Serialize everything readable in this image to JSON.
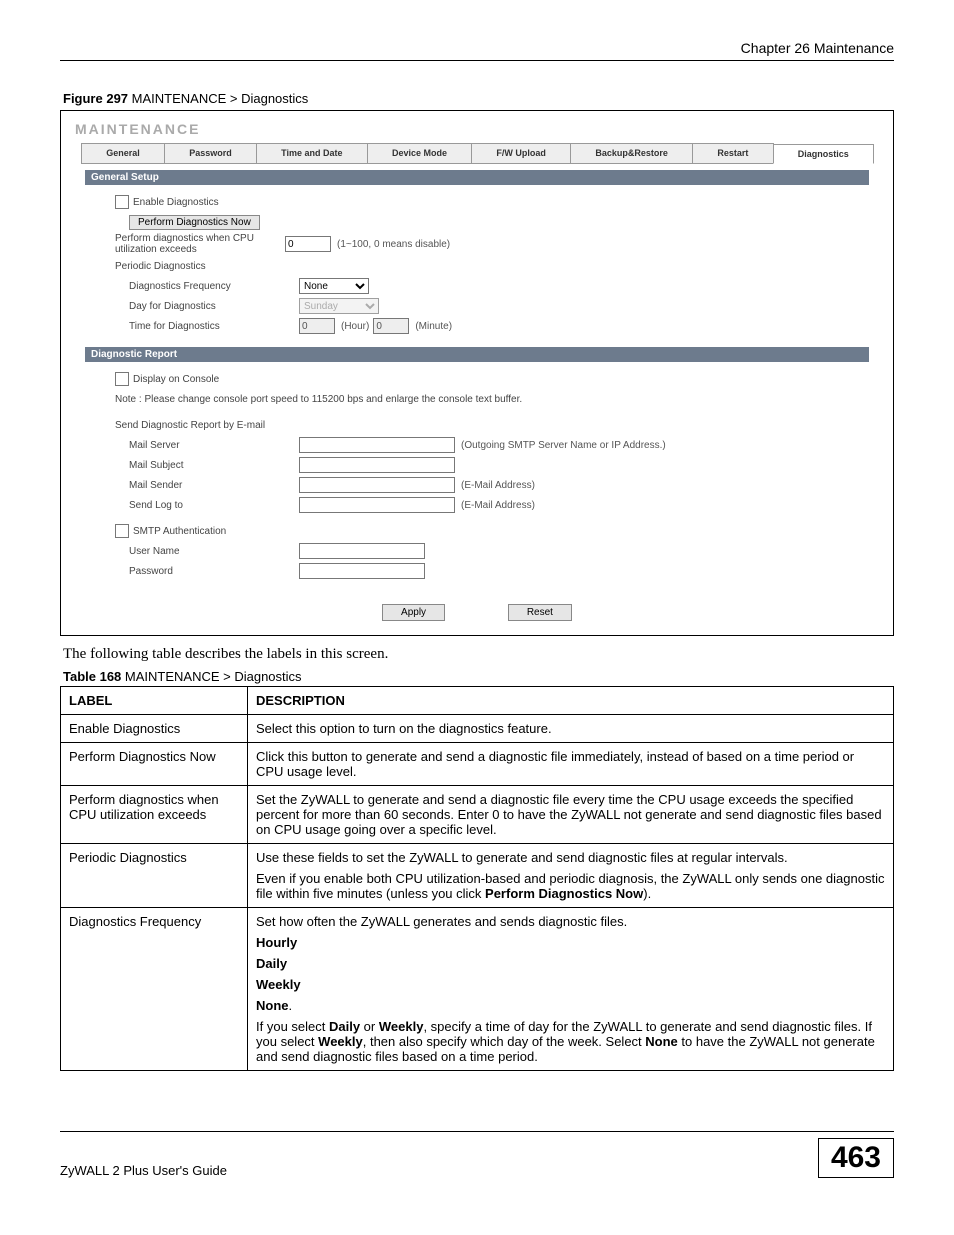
{
  "chapter_header": "Chapter 26 Maintenance",
  "figure_caption_strong": "Figure 297",
  "figure_caption_rest": "   MAINTENANCE > Diagnostics",
  "screenshot": {
    "page_title": "MAINTENANCE",
    "tabs": [
      "General",
      "Password",
      "Time and Date",
      "Device Mode",
      "F/W Upload",
      "Backup&Restore",
      "Restart",
      "Diagnostics"
    ],
    "active_tab_index": 7,
    "section1_title": "General Setup",
    "enable_diag": "Enable Diagnostics",
    "perform_now_btn": "Perform Diagnostics Now",
    "cpu_label": "Perform diagnostics when CPU utilization exceeds",
    "cpu_value": "0",
    "cpu_hint": "(1~100, 0 means disable)",
    "periodic_label": "Periodic Diagnostics",
    "freq_label": "Diagnostics Frequency",
    "freq_value": "None",
    "day_label": "Day for Diagnostics",
    "day_value": "Sunday",
    "time_label": "Time for Diagnostics",
    "time_hour": "0",
    "time_hour_hint": "(Hour)",
    "time_min": "0",
    "time_min_hint": "(Minute)",
    "section2_title": "Diagnostic Report",
    "console_label": "Display on Console",
    "console_note": "Note : Please change console port speed to 115200 bps and enlarge the console text buffer.",
    "email_header": "Send Diagnostic Report by E-mail",
    "mail_server_label": "Mail Server",
    "mail_server_hint": "(Outgoing SMTP Server Name or IP Address.)",
    "mail_subject_label": "Mail Subject",
    "mail_sender_label": "Mail Sender",
    "mail_sender_hint": "(E-Mail Address)",
    "send_log_label": "Send Log to",
    "send_log_hint": "(E-Mail Address)",
    "smtp_auth_label": "SMTP Authentication",
    "user_name_label": "User Name",
    "password_label": "Password",
    "apply_btn": "Apply",
    "reset_btn": "Reset"
  },
  "body_text": "The following table describes the labels in this screen.",
  "table_caption_strong": "Table 168",
  "table_caption_rest": "   MAINTENANCE > Diagnostics",
  "table": {
    "header_label": "LABEL",
    "header_desc": "DESCRIPTION",
    "rows": [
      {
        "label": "Enable Diagnostics",
        "desc_plain": "Select this option to turn on the diagnostics feature."
      },
      {
        "label": "Perform Diagnostics Now",
        "desc_plain": "Click this button to generate and send a diagnostic file immediately, instead of based on a time period or CPU usage level."
      },
      {
        "label": "Perform diagnostics when CPU utilization exceeds",
        "desc_plain": "Set the ZyWALL to generate and send a diagnostic file every time the CPU usage exceeds the specified percent for more than 60 seconds. Enter 0 to have the ZyWALL not generate and send diagnostic files based on CPU usage going over a specific level."
      }
    ],
    "row_periodic": {
      "label": "Periodic Diagnostics",
      "p1": "Use these fields to set the ZyWALL to generate and send diagnostic files at regular intervals.",
      "p2a": "Even if you enable both CPU utilization-based and periodic diagnosis, the ZyWALL only sends one diagnostic file within five minutes (unless you click ",
      "p2b_strong": "Perform Diagnostics Now",
      "p2c": ")."
    },
    "row_freq": {
      "label": "Diagnostics Frequency",
      "p1": "Set how often the ZyWALL generates and sends diagnostic files.",
      "opt1": "Hourly",
      "opt2": "Daily",
      "opt3": "Weekly",
      "opt4": "None",
      "p2a": "If you select ",
      "p2b_strong": "Daily",
      "p2c": " or ",
      "p2d_strong": "Weekly",
      "p2e": ", specify a time of day for the ZyWALL to generate and send diagnostic files. If you select ",
      "p2f_strong": "Weekly",
      "p2g": ", then also specify which day of the week. Select ",
      "p2h_strong": "None",
      "p2i": " to have the ZyWALL not generate and send diagnostic files based on a time period."
    }
  },
  "footer_guide": "ZyWALL 2 Plus User's Guide",
  "footer_page": "463"
}
